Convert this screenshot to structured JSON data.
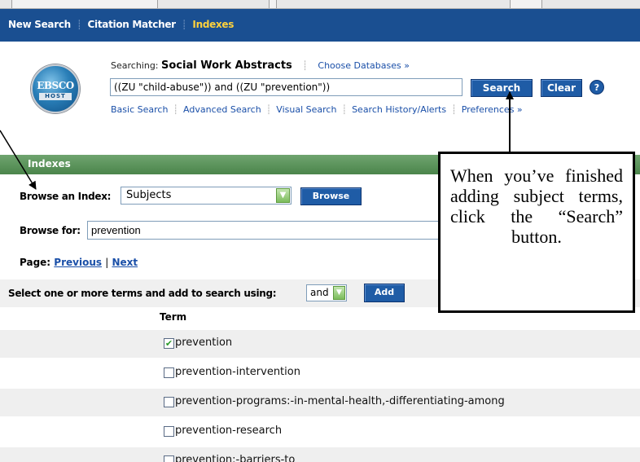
{
  "top_nav": {
    "items": [
      {
        "label": "New Search"
      },
      {
        "label": "Citation Matcher"
      },
      {
        "label": "Indexes"
      }
    ]
  },
  "logo": {
    "main": "EBSCO",
    "sub": "HOST"
  },
  "search": {
    "searching_label": "Searching:",
    "database": "Social Work Abstracts",
    "choose_databases": "Choose Databases »",
    "query": "((ZU \"child-abuse\")) and ((ZU \"prevention\"))",
    "search_button": "Search",
    "clear_button": "Clear",
    "help_icon": "?"
  },
  "sub_links": [
    {
      "label": "Basic Search"
    },
    {
      "label": "Advanced Search"
    },
    {
      "label": "Visual Search"
    },
    {
      "label": "Search History/Alerts"
    },
    {
      "label": "Preferences »"
    }
  ],
  "indexes": {
    "title": "Indexes",
    "browse_index_label": "Browse an Index:",
    "index_selected": "Subjects",
    "browse_button": "Browse",
    "browse_for_label": "Browse for:",
    "browse_for_value": "prevention",
    "page_label": "Page:",
    "previous": "Previous",
    "divider": "|",
    "next": "Next",
    "select_text": "Select one or more terms and add to search using:",
    "operator": "and",
    "add_button": "Add",
    "term_header": "Term"
  },
  "terms": [
    {
      "label": "prevention",
      "checked": true
    },
    {
      "label": "prevention-intervention",
      "checked": false
    },
    {
      "label": "prevention-programs:-in-mental-health,-differentiating-among",
      "checked": false
    },
    {
      "label": "prevention-research",
      "checked": false
    },
    {
      "label": "prevention:-barriers-to",
      "checked": false
    }
  ],
  "callout": {
    "text": "When you’ve finished adding subject terms, click the “Search”",
    "last_line": "button."
  },
  "colors": {
    "nav_bg": "#1a4f91",
    "nav_active": "#ffd23c",
    "indexes_bar": "#5a945a",
    "button_blue": "#1f5ca6",
    "link": "#1a4fa8"
  }
}
